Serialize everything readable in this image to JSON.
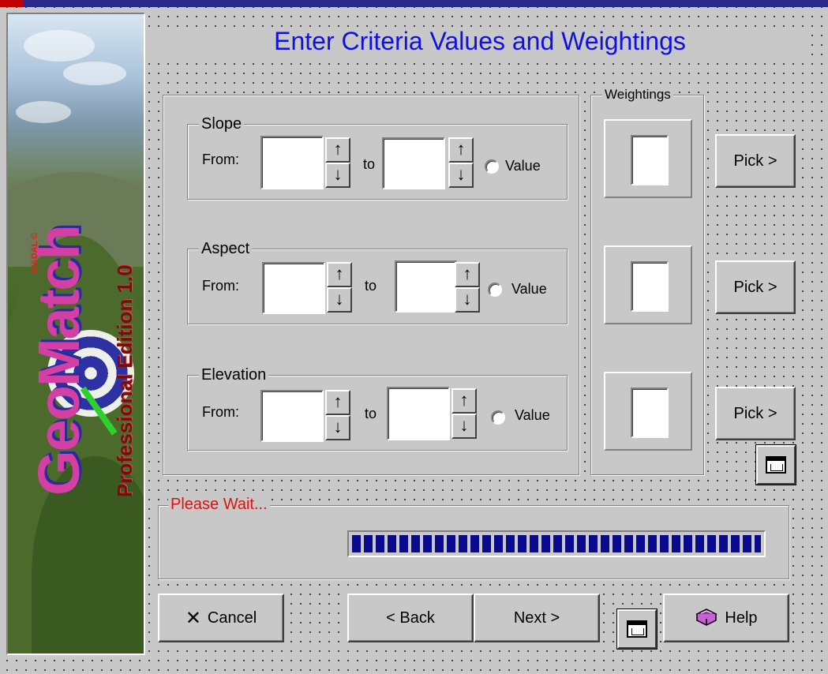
{
  "title": "Enter Criteria Values and Weightings",
  "banner": {
    "brand": "GeoMatch",
    "edition": "Professional Edition 1.0",
    "vendor": "WADAL ©"
  },
  "criteria": [
    {
      "name": "Slope",
      "from_label": "From:",
      "to_label": "to",
      "from_value": "",
      "to_value": "",
      "radio_label": "Value",
      "radio_selected": false
    },
    {
      "name": "Aspect",
      "from_label": "From:",
      "to_label": "to",
      "from_value": "",
      "to_value": "",
      "radio_label": "Value",
      "radio_selected": false
    },
    {
      "name": "Elevation",
      "from_label": "From:",
      "to_label": "to",
      "from_value": "",
      "to_value": "",
      "radio_label": "Value",
      "radio_selected": false
    }
  ],
  "weightings": {
    "label": "Weightings",
    "values": [
      "",
      "",
      ""
    ]
  },
  "pick_buttons": [
    "Pick >",
    "Pick >",
    "Pick >"
  ],
  "spin": {
    "up_glyph": "↑",
    "down_glyph": "↓"
  },
  "status": {
    "label": "Please Wait...",
    "label_color": "#e01010",
    "progress": 1.0
  },
  "buttons": {
    "cancel": "Cancel",
    "cancel_icon": "✕",
    "back": "< Back",
    "next": "Next >",
    "help": "Help",
    "help_icon": "book-icon"
  },
  "colors": {
    "title": "#1010e0",
    "progress": "#0a0a8c",
    "face": "#c8c8c8"
  }
}
